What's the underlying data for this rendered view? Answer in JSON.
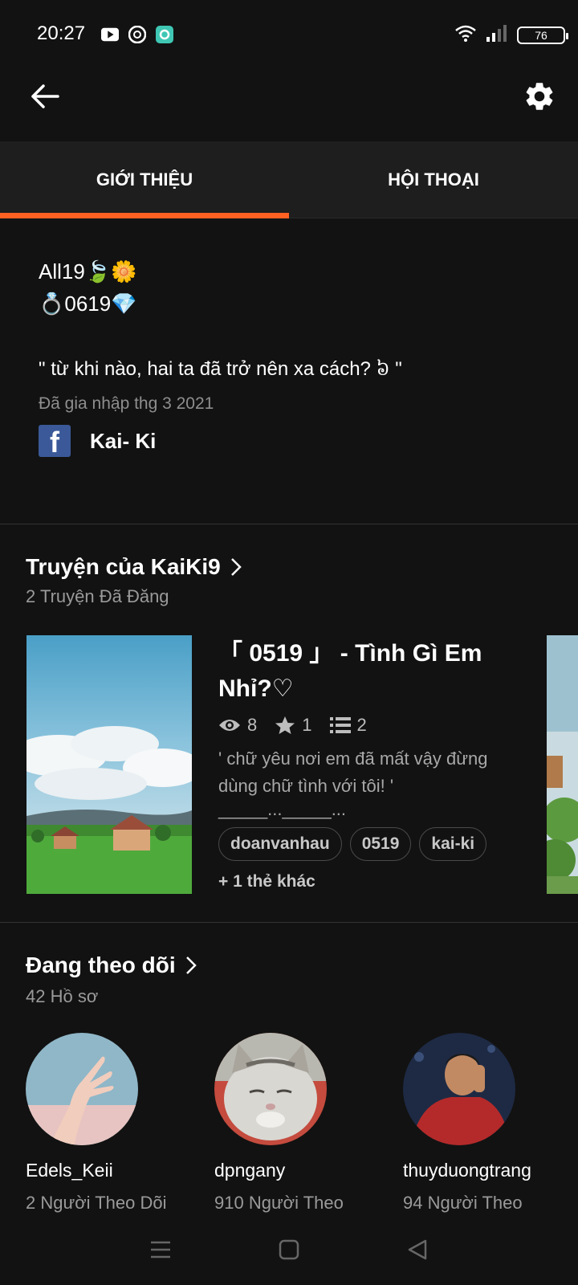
{
  "status_bar": {
    "time": "20:27",
    "battery": "76",
    "icons": [
      "youtube-icon",
      "shutter-icon",
      "app-icon",
      "wifi-icon",
      "signal-icon",
      "battery-icon"
    ]
  },
  "top_bar": {
    "icons": [
      "back-arrow-icon",
      "gear-icon"
    ]
  },
  "tabs": [
    {
      "label": "GIỚI THIỆU",
      "active": true
    },
    {
      "label": "HỘI THOẠI",
      "active": false
    }
  ],
  "about": {
    "bio_line1": "All19🍃🌼",
    "bio_line2": "💍0619💎",
    "quote": "\" từ khi nào, hai ta đã trở nên xa cách? ៦ \"",
    "joined": "Đã gia nhập thg 3 2021",
    "facebook_name": "Kai- Ki"
  },
  "stories": {
    "title": "Truyện của KaiKi9",
    "subtitle": "2 Truyện Đã Đăng",
    "items": [
      {
        "title": "「 0519 」 - Tình Gì Em Nhỉ?♡",
        "views": "8",
        "votes": "1",
        "parts": "2",
        "description": "' chữ yêu nơi em đã mất vậy đừng dùng chữ tình với tôi! '",
        "description2": "_____..._____...",
        "tags": [
          "doanvanhau",
          "0519",
          "kai-ki"
        ],
        "more_tags": "+ 1 thẻ khác"
      }
    ]
  },
  "following": {
    "title": "Đang theo dõi",
    "subtitle": "42 Hồ sơ",
    "profiles": [
      {
        "name": "Edels_Keii",
        "followers": "2 Người Theo Dõi"
      },
      {
        "name": "dpngany",
        "followers": "910 Người Theo"
      },
      {
        "name": "thuyduongtrang",
        "followers": "94 Người Theo"
      }
    ]
  },
  "colors": {
    "accent": "#ff6122",
    "background": "#121212",
    "tab_bar": "#1e1e1e",
    "facebook": "#3b5998"
  }
}
